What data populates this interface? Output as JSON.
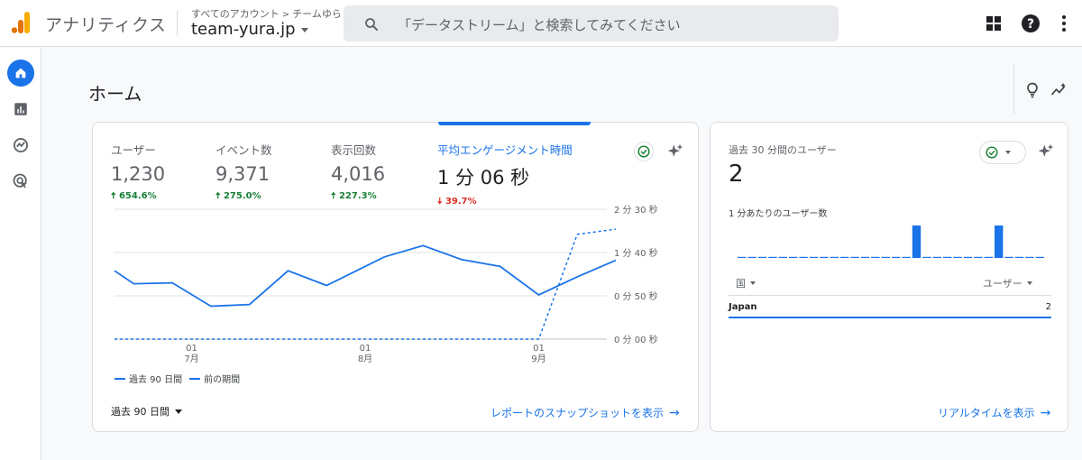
{
  "app": {
    "title": "アナリティクス",
    "breadcrumb_root": "すべてのアカウント",
    "breadcrumb_sep": ">",
    "breadcrumb_account": "チームゆら",
    "property": "team-yura.jp"
  },
  "search": {
    "placeholder": "「データストリーム」と検索してみてください"
  },
  "page": {
    "title": "ホーム"
  },
  "metrics": [
    {
      "label": "ユーザー",
      "value": "1,230",
      "arrow": "🠅",
      "change": "654.6%",
      "trend": "up"
    },
    {
      "label": "イベント数",
      "value": "9,371",
      "arrow": "🠅",
      "change": "275.0%",
      "trend": "up"
    },
    {
      "label": "表示回数",
      "value": "4,016",
      "arrow": "🠅",
      "change": "227.3%",
      "trend": "up"
    },
    {
      "label": "平均エンゲージメント時間",
      "value": "1 分 06 秒",
      "arrow": "🠇",
      "change": "39.7%",
      "trend": "down"
    }
  ],
  "chart_data": {
    "type": "line",
    "y_tick_labels": [
      "2 分 30 秒",
      "1 分 40 秒",
      "0 分 50 秒",
      "0 分 00 秒"
    ],
    "ylim": [
      0,
      150
    ],
    "x_ticks": [
      {
        "day": "01",
        "month": "7月",
        "at": 4
      },
      {
        "day": "01",
        "month": "8月",
        "at": 13
      },
      {
        "day": "01",
        "month": "9月",
        "at": 22
      }
    ],
    "n_points": 27,
    "series": [
      {
        "name": "過去 90 日間",
        "style": "solid",
        "points": [
          [
            0,
            79
          ],
          [
            1,
            64
          ],
          [
            3,
            65
          ],
          [
            5,
            38
          ],
          [
            7,
            40
          ],
          [
            9,
            79
          ],
          [
            11,
            62
          ],
          [
            14,
            95
          ],
          [
            16,
            108
          ],
          [
            18,
            92
          ],
          [
            20,
            84
          ],
          [
            22,
            51
          ],
          [
            24,
            72
          ],
          [
            26,
            91
          ]
        ]
      },
      {
        "name": "前の期間",
        "style": "dashed",
        "points": [
          [
            0,
            0
          ],
          [
            22,
            0
          ],
          [
            24,
            121
          ],
          [
            26,
            127
          ]
        ]
      }
    ],
    "grid": true,
    "legend": "bottom-left"
  },
  "controls": {
    "range": "過去 90 日間",
    "snapshot_link": "レポートのスナップショットを表示",
    "realtime_link": "リアルタイムを表示"
  },
  "realtime": {
    "title": "過去 30 分間のユーザー",
    "value": "2",
    "subtitle": "1 分あたりのユーザー数",
    "bars": [
      0,
      0,
      0,
      0,
      0,
      0,
      0,
      0,
      0,
      0,
      0,
      0,
      0,
      0,
      0,
      0,
      0,
      1,
      0,
      0,
      0,
      0,
      0,
      0,
      0,
      1,
      0,
      0,
      0,
      0
    ],
    "col_country": "国",
    "col_users": "ユーザー",
    "rows": [
      {
        "country": "Japan",
        "users": "2"
      }
    ]
  },
  "colors": {
    "accent": "#1a73e8",
    "up": "#188038",
    "down": "#d93025",
    "logo_orange": "#f9ab00",
    "logo_dark": "#e37400"
  },
  "icons": [
    "search-icon",
    "apps-icon",
    "help-icon",
    "more-vert-icon",
    "home-icon",
    "reports-icon",
    "explore-icon",
    "advertising-icon",
    "lightbulb-icon",
    "insights-trend-icon",
    "check-circle-icon",
    "sparkle-icon",
    "arrow-right-icon"
  ]
}
